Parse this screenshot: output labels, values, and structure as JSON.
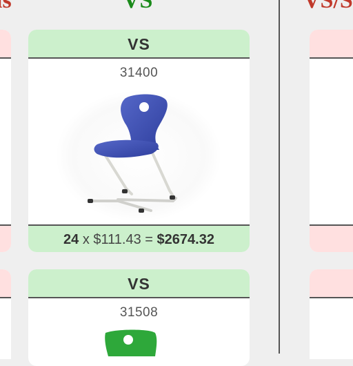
{
  "headers": {
    "left": "ls",
    "middle": "VS",
    "right": "VS/S"
  },
  "cards": [
    {
      "title": "VS",
      "code": "31400",
      "qty": "24",
      "times": "x",
      "price": "$111.43",
      "equals": "=",
      "total": "$2674.32",
      "image": "blue-chair-icon"
    },
    {
      "title": "VS",
      "code": "31508",
      "image": "green-chair-icon"
    }
  ],
  "colors": {
    "accent_green": "#ccf0cc",
    "accent_red": "#ffe0e0",
    "header_green": "#1a8a1a",
    "header_red": "#c0392b"
  }
}
